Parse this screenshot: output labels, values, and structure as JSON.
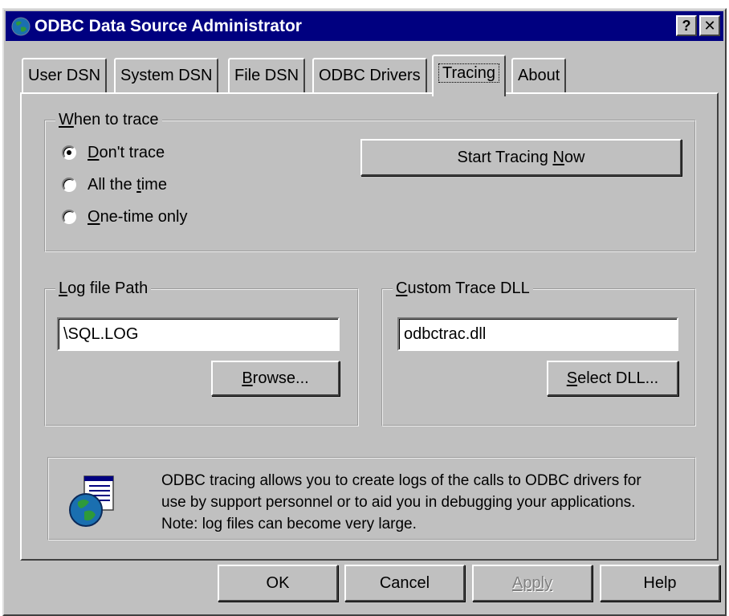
{
  "window": {
    "title": "ODBC Data Source Administrator",
    "help_button": "?",
    "close_button": "✕"
  },
  "tabs": [
    {
      "label": "User DSN"
    },
    {
      "label": "System DSN"
    },
    {
      "label": "File DSN"
    },
    {
      "label": "ODBC Drivers"
    },
    {
      "label": "Tracing",
      "active": true
    },
    {
      "label": "About"
    }
  ],
  "when_to_trace": {
    "legend": "When to trace",
    "options": [
      {
        "label": "Don't trace",
        "selected": true
      },
      {
        "label": "All the time",
        "selected": false
      },
      {
        "label": "One-time only",
        "selected": false
      }
    ],
    "start_button": "Start Tracing Now"
  },
  "log_file": {
    "legend": "Log file Path",
    "value": "\\SQL.LOG",
    "browse_button": "Browse..."
  },
  "custom_dll": {
    "legend": "Custom Trace DLL",
    "value": "odbctrac.dll",
    "select_button": "Select DLL..."
  },
  "info": {
    "icon": "odbc-globe-icon",
    "lines": [
      "ODBC tracing allows you to create logs of the calls to ODBC drivers for",
      "use by support personnel or to aid you in debugging your applications.",
      "Note: log files can become very large."
    ]
  },
  "footer": {
    "ok": "OK",
    "cancel": "Cancel",
    "apply": "Apply",
    "help": "Help"
  },
  "colors": {
    "dialog_bg": "#c0c0c0",
    "titlebar": "#000080",
    "title_text": "#ffffff"
  }
}
